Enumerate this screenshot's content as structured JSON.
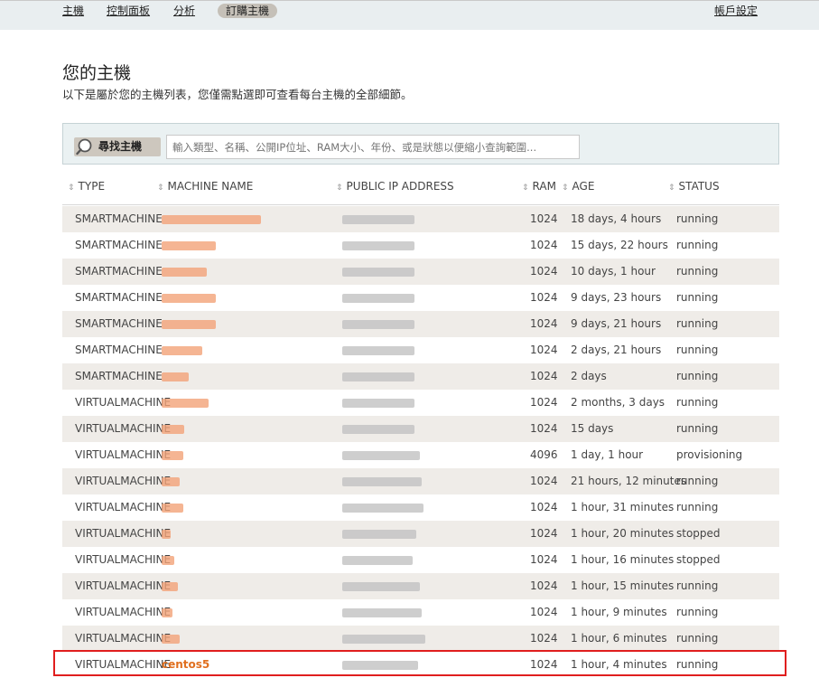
{
  "nav": {
    "items": [
      "主機",
      "控制面板",
      "分析",
      "訂購主機"
    ],
    "account": "帳戶設定",
    "active_index": 3
  },
  "page": {
    "title": "您的主機",
    "subtitle": "以下是屬於您的主機列表，您僅需點選即可查看每台主機的全部細節。"
  },
  "search": {
    "label": "尋找主機",
    "placeholder": "輸入類型、名稱、公開IP位址、RAM大小、年份、或是狀態以便縮小查詢範圍..."
  },
  "table": {
    "columns": [
      "TYPE",
      "MACHINE NAME",
      "PUBLIC IP ADDRESS",
      "RAM",
      "AGE",
      "STATUS"
    ],
    "rows": [
      {
        "type": "SMARTMACHINE",
        "name": "",
        "ram": "1024",
        "age": "18 days, 4 hours",
        "status": "running"
      },
      {
        "type": "SMARTMACHINE",
        "name": "",
        "ram": "1024",
        "age": "15 days, 22 hours",
        "status": "running"
      },
      {
        "type": "SMARTMACHINE",
        "name": "",
        "ram": "1024",
        "age": "10 days, 1 hour",
        "status": "running"
      },
      {
        "type": "SMARTMACHINE",
        "name": "",
        "ram": "1024",
        "age": "9 days, 23 hours",
        "status": "running"
      },
      {
        "type": "SMARTMACHINE",
        "name": "",
        "ram": "1024",
        "age": "9 days, 21 hours",
        "status": "running"
      },
      {
        "type": "SMARTMACHINE",
        "name": "",
        "ram": "1024",
        "age": "2 days, 21 hours",
        "status": "running"
      },
      {
        "type": "SMARTMACHINE",
        "name": "",
        "ram": "1024",
        "age": "2 days",
        "status": "running"
      },
      {
        "type": "VIRTUALMACHINE",
        "name": "",
        "ram": "1024",
        "age": "2 months, 3 days",
        "status": "running"
      },
      {
        "type": "VIRTUALMACHINE",
        "name": "",
        "ram": "1024",
        "age": "15 days",
        "status": "running"
      },
      {
        "type": "VIRTUALMACHINE",
        "name": "",
        "ram": "4096",
        "age": "1 day, 1 hour",
        "status": "provisioning"
      },
      {
        "type": "VIRTUALMACHINE",
        "name": "",
        "ram": "1024",
        "age": "21 hours, 12 minutes",
        "status": "running"
      },
      {
        "type": "VIRTUALMACHINE",
        "name": "",
        "ram": "1024",
        "age": "1 hour, 31 minutes",
        "status": "running"
      },
      {
        "type": "VIRTUALMACHINE",
        "name": "",
        "ram": "1024",
        "age": "1 hour, 20 minutes",
        "status": "stopped"
      },
      {
        "type": "VIRTUALMACHINE",
        "name": "",
        "ram": "1024",
        "age": "1 hour, 16 minutes",
        "status": "stopped"
      },
      {
        "type": "VIRTUALMACHINE",
        "name": "",
        "ram": "1024",
        "age": "1 hour, 15 minutes",
        "status": "running"
      },
      {
        "type": "VIRTUALMACHINE",
        "name": "",
        "ram": "1024",
        "age": "1 hour, 9 minutes",
        "status": "running"
      },
      {
        "type": "VIRTUALMACHINE",
        "name": "",
        "ram": "1024",
        "age": "1 hour, 6 minutes",
        "status": "running"
      },
      {
        "type": "VIRTUALMACHINE",
        "name": "centos5",
        "ram": "1024",
        "age": "1 hour, 4 minutes",
        "status": "running"
      }
    ]
  },
  "colors": {
    "accent": "#e07020",
    "highlight": "#e01e1e",
    "row_alt": "#efece8",
    "search_bg": "#eaf1f2"
  }
}
